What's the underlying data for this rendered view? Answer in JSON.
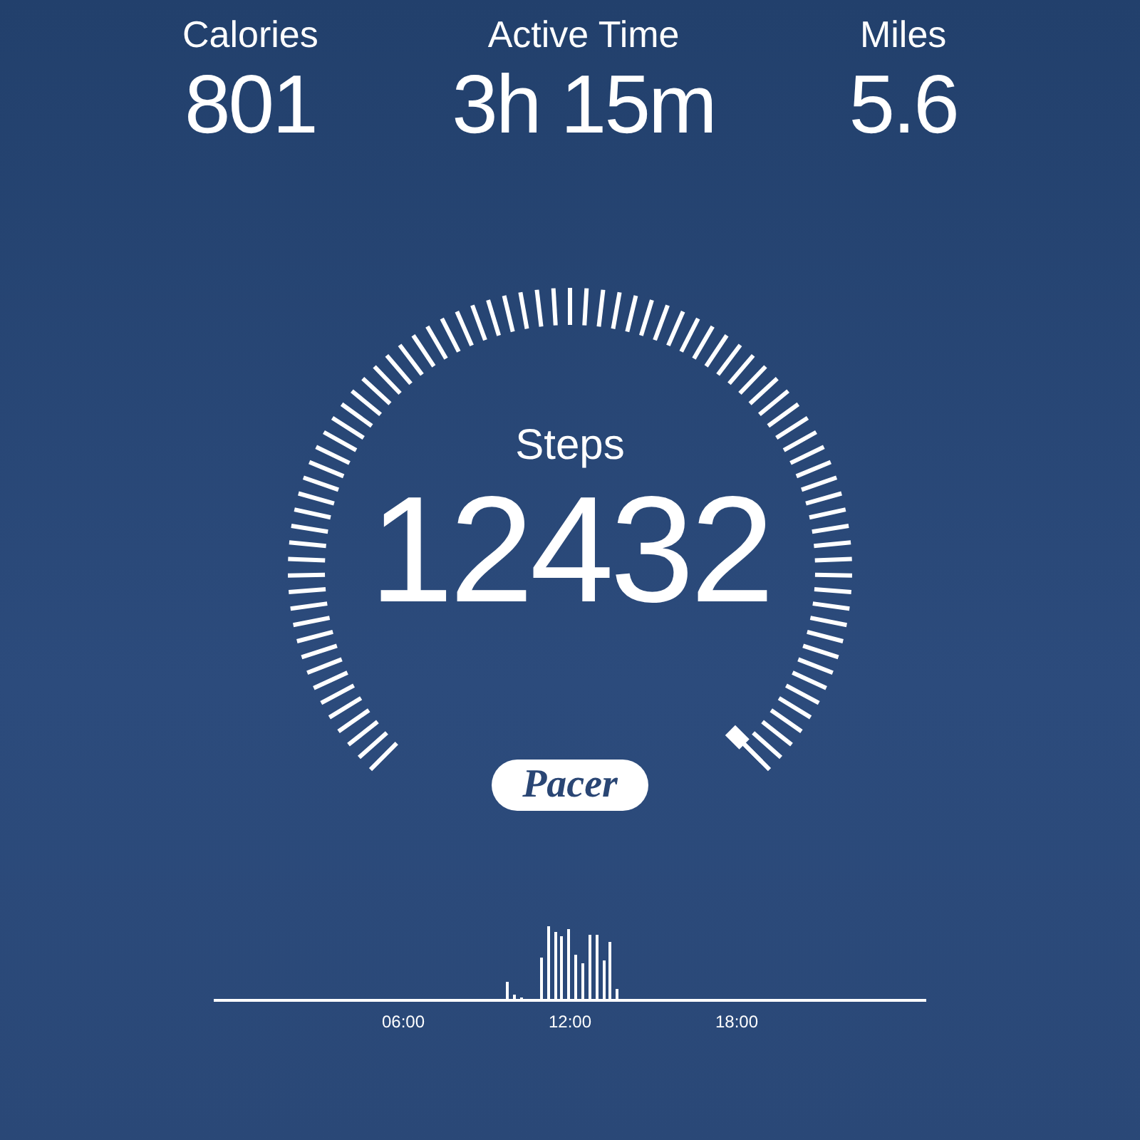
{
  "stats": [
    {
      "label": "Calories",
      "value": "801"
    },
    {
      "label": "Active Time",
      "value": "3h 15m"
    },
    {
      "label": "Miles",
      "value": "5.6"
    }
  ],
  "gauge": {
    "label": "Steps",
    "value": "12432"
  },
  "logo": "Pacer",
  "activity_chart": {
    "x_labels": [
      "06:00",
      "12:00",
      "18:00"
    ]
  }
}
